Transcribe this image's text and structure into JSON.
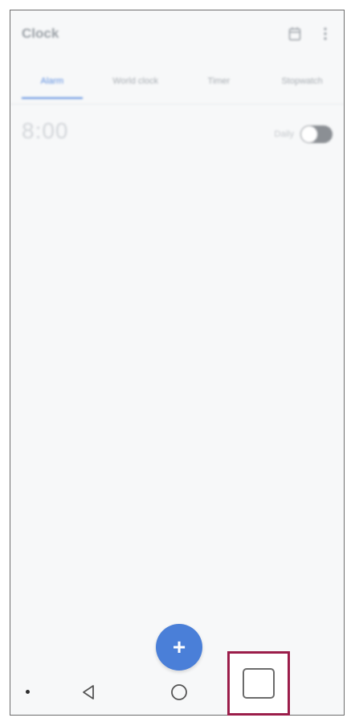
{
  "app": {
    "title": "Clock"
  },
  "appbar": {
    "calendar_icon": "calendar-icon",
    "more_icon": "more-vert-icon"
  },
  "tabs": [
    {
      "label": "Alarm",
      "active": true
    },
    {
      "label": "World clock",
      "active": false
    },
    {
      "label": "Timer",
      "active": false
    },
    {
      "label": "Stopwatch",
      "active": false
    }
  ],
  "alarm": {
    "time": "8:00",
    "status": "Daily",
    "enabled": false
  },
  "fab": {
    "label": "+"
  },
  "navbar": {
    "back_icon": "back-triangle-icon",
    "home_icon": "home-circle-icon",
    "recents_icon": "recents-square-icon"
  },
  "colors": {
    "accent": "#4a7fd8",
    "highlight": "#9b1d4a"
  }
}
